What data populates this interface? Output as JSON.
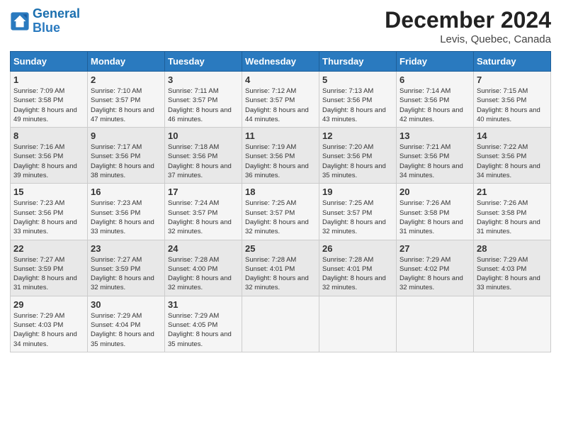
{
  "logo": {
    "line1": "General",
    "line2": "Blue"
  },
  "title": "December 2024",
  "subtitle": "Levis, Quebec, Canada",
  "days_header": [
    "Sunday",
    "Monday",
    "Tuesday",
    "Wednesday",
    "Thursday",
    "Friday",
    "Saturday"
  ],
  "weeks": [
    [
      {
        "day": "1",
        "sunrise": "7:09 AM",
        "sunset": "3:58 PM",
        "daylight": "8 hours and 49 minutes."
      },
      {
        "day": "2",
        "sunrise": "7:10 AM",
        "sunset": "3:57 PM",
        "daylight": "8 hours and 47 minutes."
      },
      {
        "day": "3",
        "sunrise": "7:11 AM",
        "sunset": "3:57 PM",
        "daylight": "8 hours and 46 minutes."
      },
      {
        "day": "4",
        "sunrise": "7:12 AM",
        "sunset": "3:57 PM",
        "daylight": "8 hours and 44 minutes."
      },
      {
        "day": "5",
        "sunrise": "7:13 AM",
        "sunset": "3:56 PM",
        "daylight": "8 hours and 43 minutes."
      },
      {
        "day": "6",
        "sunrise": "7:14 AM",
        "sunset": "3:56 PM",
        "daylight": "8 hours and 42 minutes."
      },
      {
        "day": "7",
        "sunrise": "7:15 AM",
        "sunset": "3:56 PM",
        "daylight": "8 hours and 40 minutes."
      }
    ],
    [
      {
        "day": "8",
        "sunrise": "7:16 AM",
        "sunset": "3:56 PM",
        "daylight": "8 hours and 39 minutes."
      },
      {
        "day": "9",
        "sunrise": "7:17 AM",
        "sunset": "3:56 PM",
        "daylight": "8 hours and 38 minutes."
      },
      {
        "day": "10",
        "sunrise": "7:18 AM",
        "sunset": "3:56 PM",
        "daylight": "8 hours and 37 minutes."
      },
      {
        "day": "11",
        "sunrise": "7:19 AM",
        "sunset": "3:56 PM",
        "daylight": "8 hours and 36 minutes."
      },
      {
        "day": "12",
        "sunrise": "7:20 AM",
        "sunset": "3:56 PM",
        "daylight": "8 hours and 35 minutes."
      },
      {
        "day": "13",
        "sunrise": "7:21 AM",
        "sunset": "3:56 PM",
        "daylight": "8 hours and 34 minutes."
      },
      {
        "day": "14",
        "sunrise": "7:22 AM",
        "sunset": "3:56 PM",
        "daylight": "8 hours and 34 minutes."
      }
    ],
    [
      {
        "day": "15",
        "sunrise": "7:23 AM",
        "sunset": "3:56 PM",
        "daylight": "8 hours and 33 minutes."
      },
      {
        "day": "16",
        "sunrise": "7:23 AM",
        "sunset": "3:56 PM",
        "daylight": "8 hours and 33 minutes."
      },
      {
        "day": "17",
        "sunrise": "7:24 AM",
        "sunset": "3:57 PM",
        "daylight": "8 hours and 32 minutes."
      },
      {
        "day": "18",
        "sunrise": "7:25 AM",
        "sunset": "3:57 PM",
        "daylight": "8 hours and 32 minutes."
      },
      {
        "day": "19",
        "sunrise": "7:25 AM",
        "sunset": "3:57 PM",
        "daylight": "8 hours and 32 minutes."
      },
      {
        "day": "20",
        "sunrise": "7:26 AM",
        "sunset": "3:58 PM",
        "daylight": "8 hours and 31 minutes."
      },
      {
        "day": "21",
        "sunrise": "7:26 AM",
        "sunset": "3:58 PM",
        "daylight": "8 hours and 31 minutes."
      }
    ],
    [
      {
        "day": "22",
        "sunrise": "7:27 AM",
        "sunset": "3:59 PM",
        "daylight": "8 hours and 31 minutes."
      },
      {
        "day": "23",
        "sunrise": "7:27 AM",
        "sunset": "3:59 PM",
        "daylight": "8 hours and 32 minutes."
      },
      {
        "day": "24",
        "sunrise": "7:28 AM",
        "sunset": "4:00 PM",
        "daylight": "8 hours and 32 minutes."
      },
      {
        "day": "25",
        "sunrise": "7:28 AM",
        "sunset": "4:01 PM",
        "daylight": "8 hours and 32 minutes."
      },
      {
        "day": "26",
        "sunrise": "7:28 AM",
        "sunset": "4:01 PM",
        "daylight": "8 hours and 32 minutes."
      },
      {
        "day": "27",
        "sunrise": "7:29 AM",
        "sunset": "4:02 PM",
        "daylight": "8 hours and 32 minutes."
      },
      {
        "day": "28",
        "sunrise": "7:29 AM",
        "sunset": "4:03 PM",
        "daylight": "8 hours and 33 minutes."
      }
    ],
    [
      {
        "day": "29",
        "sunrise": "7:29 AM",
        "sunset": "4:03 PM",
        "daylight": "8 hours and 34 minutes."
      },
      {
        "day": "30",
        "sunrise": "7:29 AM",
        "sunset": "4:04 PM",
        "daylight": "8 hours and 35 minutes."
      },
      {
        "day": "31",
        "sunrise": "7:29 AM",
        "sunset": "4:05 PM",
        "daylight": "8 hours and 35 minutes."
      },
      null,
      null,
      null,
      null
    ]
  ]
}
